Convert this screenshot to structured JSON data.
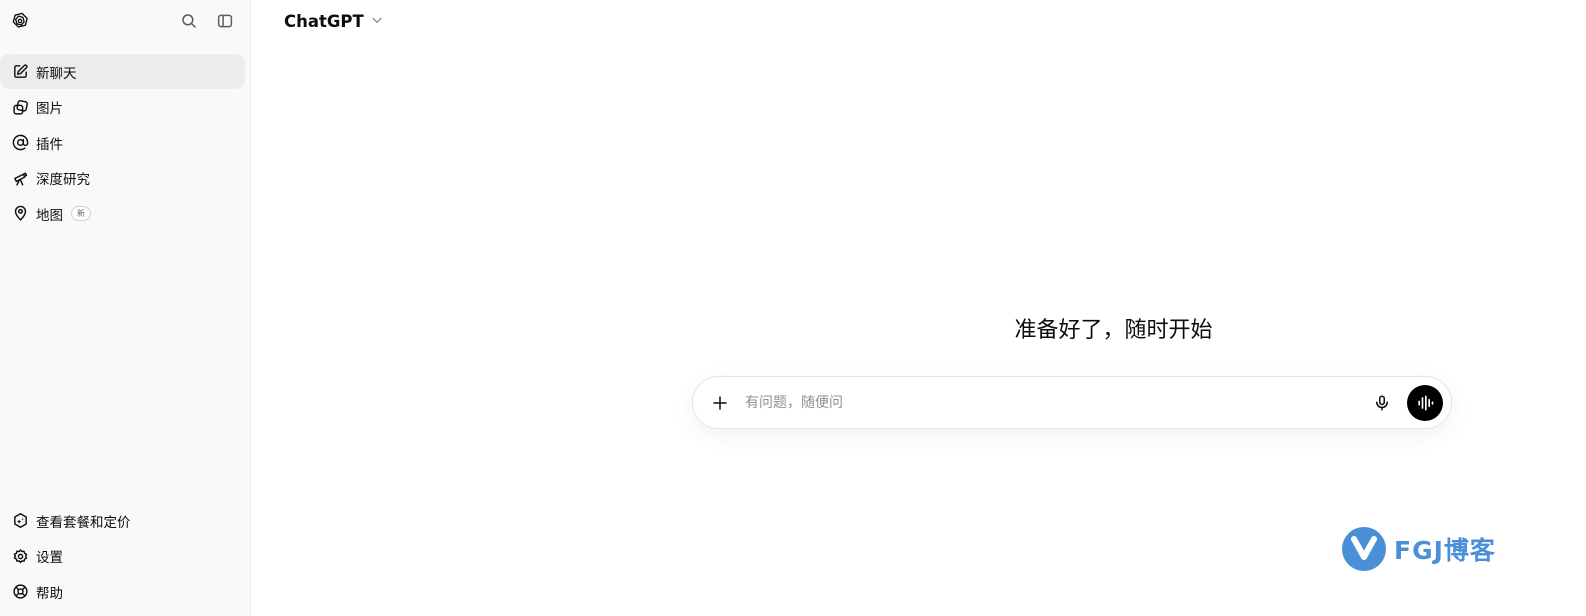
{
  "sidebar": {
    "logo_icon": "openai-logo-icon",
    "search_icon": "search-icon",
    "toggle_icon": "sidebar-toggle-icon",
    "items": [
      {
        "label": "新聊天",
        "icon": "compose-icon",
        "active": true
      },
      {
        "label": "图片",
        "icon": "images-icon"
      },
      {
        "label": "插件",
        "icon": "at-icon"
      },
      {
        "label": "深度研究",
        "icon": "telescope-icon"
      },
      {
        "label": "地图",
        "icon": "map-pin-icon",
        "badge": "新"
      }
    ],
    "bottom_items": [
      {
        "label": "查看套餐和定价",
        "icon": "upgrade-icon"
      },
      {
        "label": "设置",
        "icon": "gear-icon"
      },
      {
        "label": "帮助",
        "icon": "lifebuoy-icon"
      }
    ]
  },
  "topbar": {
    "model_name": "ChatGPT",
    "dropdown_icon": "chevron-down-icon"
  },
  "hero": {
    "title": "准备好了，随时开始"
  },
  "composer": {
    "placeholder": "有问题，随便问",
    "value": "",
    "plus_icon": "plus-icon",
    "mic_icon": "microphone-icon",
    "voice_icon": "voice-mode-icon"
  },
  "watermark": {
    "text": "FGJ博客"
  },
  "colors": {
    "sidebar_bg": "#f9f9f9",
    "active_item_bg": "#ececec",
    "voice_button_bg": "#000000",
    "watermark_blue": "#4a90d9"
  }
}
